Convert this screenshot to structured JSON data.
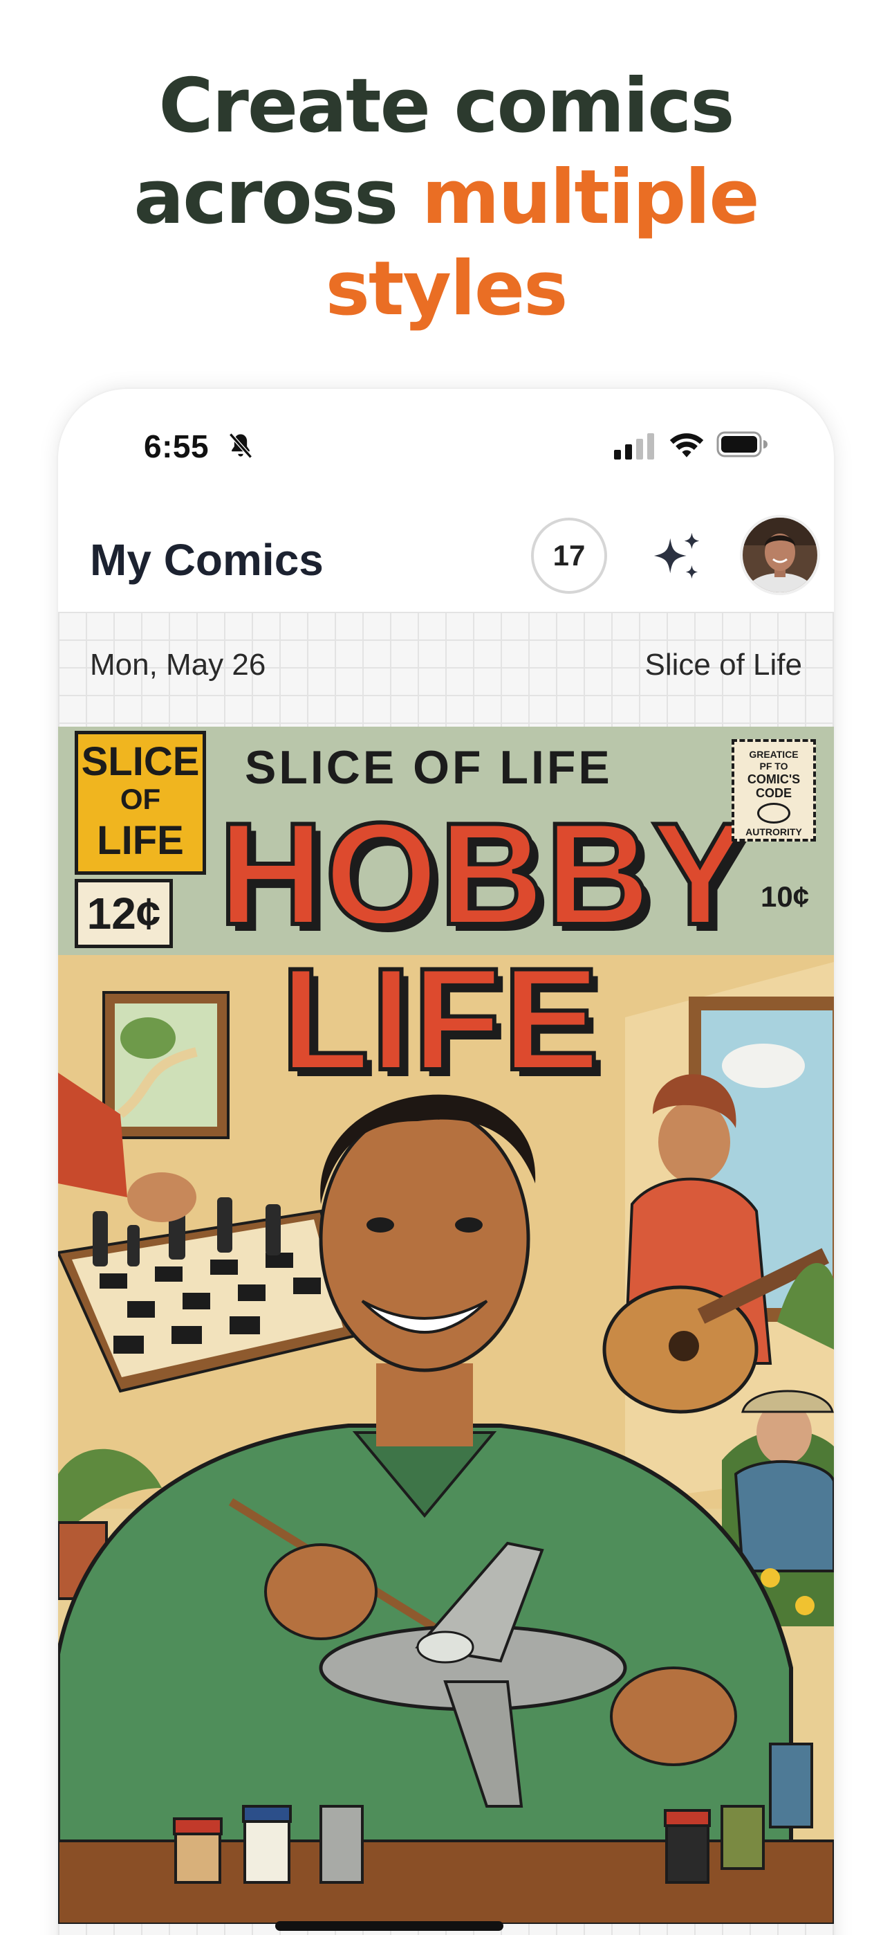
{
  "headline": {
    "line1": "Create comics",
    "line2_start": "across ",
    "line2_accent": "multiple",
    "line3": "styles"
  },
  "status_bar": {
    "time": "6:55"
  },
  "app_bar": {
    "title": "My Comics",
    "credits": "17"
  },
  "entry": {
    "date": "Mon, May 26",
    "style": "Slice of Life"
  },
  "cover": {
    "corner_tag": [
      "SLICE",
      "OF",
      "LIFE"
    ],
    "corner_price": "12¢",
    "series": "SLICE OF LIFE",
    "title_line1": "HOBBY",
    "title_line2": "LIFE",
    "seal_text": [
      "GREATICE",
      "PF TO",
      "COMIC'S",
      "CODE",
      "AUTRORITY"
    ],
    "price": "10¢"
  },
  "colors": {
    "headline_dark": "#2c3a2e",
    "accent": "#ea6e24",
    "cover_title": "#dd4a2e"
  },
  "icons": [
    "bell-slash-icon",
    "cellular-signal-icon",
    "wifi-icon",
    "battery-icon",
    "sparkle-icon"
  ]
}
